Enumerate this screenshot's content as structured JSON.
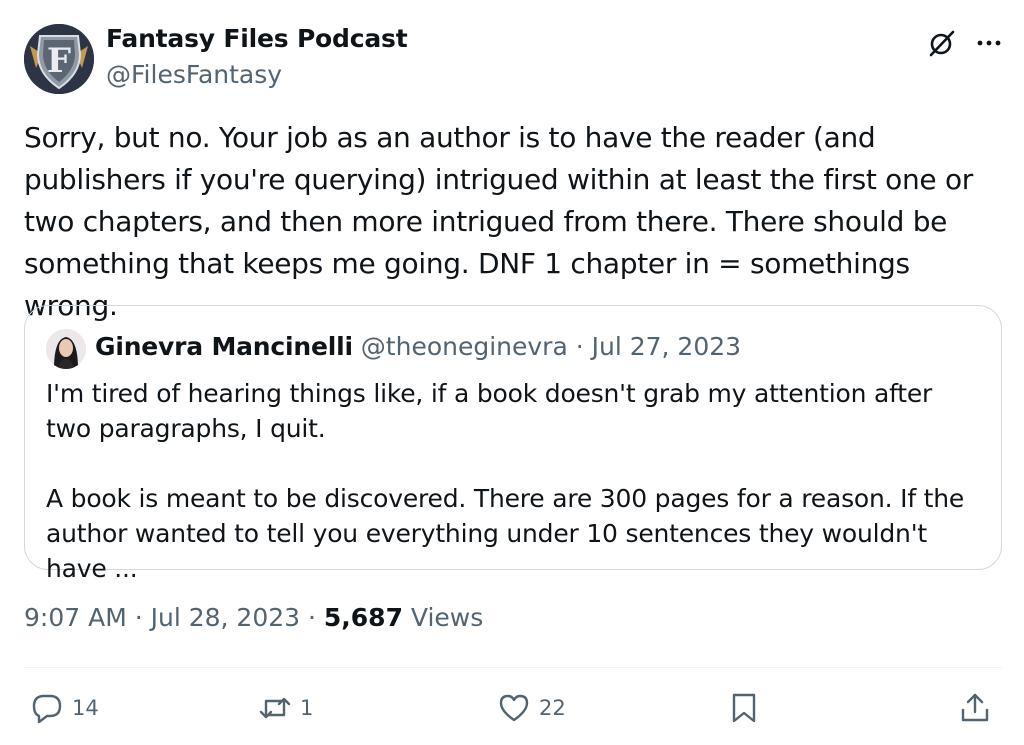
{
  "author": {
    "display_name": "Fantasy Files Podcast",
    "handle": "@FilesFantasy",
    "avatar_letter": "F"
  },
  "tweet_text": "Sorry, but no. Your job as an author is to have the reader (and publishers if you're querying) intrigued within at least the first one or two chapters, and then more intrigued from there. There should be something that keeps me going. DNF 1 chapter in = somethings wrong.",
  "quoted": {
    "name": "Ginevra Mancinelli",
    "handle": "@theoneginevra",
    "meta": "@theoneginevra · Jul 27, 2023",
    "paragraph_1": "I'm tired of hearing things like, if a book doesn't grab my attention after two paragraphs, I quit.",
    "paragraph_2": "A book is meant to be discovered. There are 300 pages for a reason. If the author wanted to tell you everything under 10 sentences they wouldn't have ..."
  },
  "meta": {
    "time_date": "9:07 AM · Jul 28, 2023 · ",
    "views_count": "5,687",
    "views_label": "Views"
  },
  "actions": {
    "replies": "14",
    "reposts": "1",
    "likes": "22"
  },
  "icons": {
    "grok": "grok-icon",
    "more": "more-icon",
    "reply": "reply-icon",
    "repost": "repost-icon",
    "like": "heart-icon",
    "bookmark": "bookmark-icon",
    "share": "share-icon"
  },
  "colors": {
    "text": "#0f1419",
    "secondary": "#536471",
    "border": "#cfd9de"
  }
}
